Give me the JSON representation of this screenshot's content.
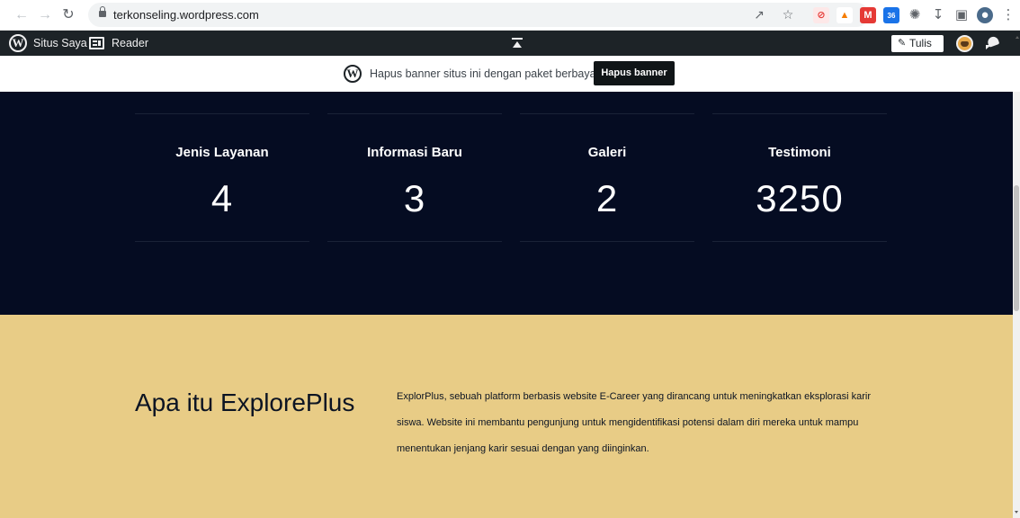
{
  "browser": {
    "url": "terkonseling.wordpress.com",
    "icons": [
      "back-icon",
      "forward-icon",
      "reload-icon",
      "lock-icon",
      "share-icon",
      "star-icon",
      "extensions-icon",
      "download-icon",
      "sidepanel-icon",
      "profile-icon",
      "menu-icon"
    ],
    "extension_badge": "36"
  },
  "wpbar": {
    "my_site": "Situs Saya",
    "reader": "Reader",
    "write": "Tulis"
  },
  "banner": {
    "text": "Hapus banner situs ini dengan paket berbayar",
    "button": "Hapus banner"
  },
  "stats": [
    {
      "label": "Jenis Layanan",
      "value": "4"
    },
    {
      "label": "Informasi Baru",
      "value": "3"
    },
    {
      "label": "Galeri",
      "value": "2"
    },
    {
      "label": "Testimoni",
      "value": "3250"
    }
  ],
  "about": {
    "title": "Apa itu ExplorePlus",
    "text": "ExplorPlus, sebuah platform berbasis website E-Career yang dirancang untuk meningkatkan eksplorasi karir siswa. Website ini membantu pengunjung untuk mengidentifikasi potensi dalam diri mereka untuk mampu menentukan jenjang karir sesuai dengan yang diinginkan."
  },
  "colors": {
    "stats_bg": "#050c22",
    "about_bg": "#e8cc86",
    "wpbar_bg": "#1d2327"
  }
}
